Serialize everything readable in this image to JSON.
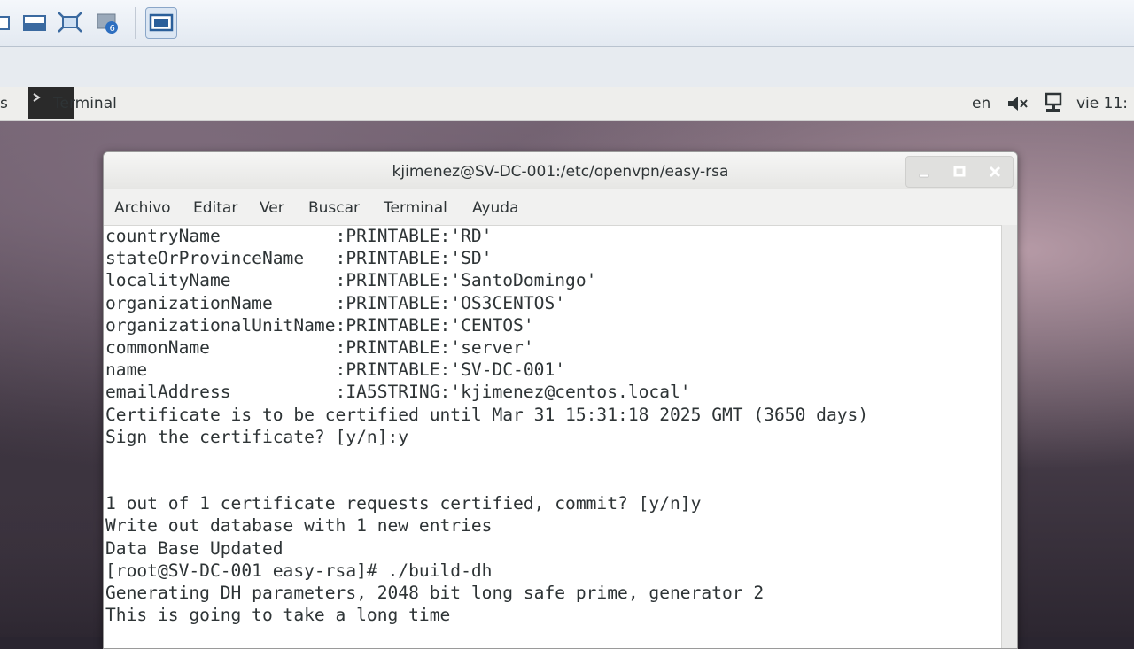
{
  "gnome_bar": {
    "activities": "s",
    "app_name": "Terminal",
    "language": "en",
    "clock": "vie 11:"
  },
  "window": {
    "title": "kjimenez@SV-DC-001:/etc/openvpn/easy-rsa",
    "menu": [
      "Archivo",
      "Editar",
      "Ver",
      "Buscar",
      "Terminal",
      "Ayuda"
    ]
  },
  "terminal": {
    "lines": [
      "countryName           :PRINTABLE:'RD'",
      "stateOrProvinceName   :PRINTABLE:'SD'",
      "localityName          :PRINTABLE:'SantoDomingo'",
      "organizationName      :PRINTABLE:'OS3CENTOS'",
      "organizationalUnitName:PRINTABLE:'CENTOS'",
      "commonName            :PRINTABLE:'server'",
      "name                  :PRINTABLE:'SV-DC-001'",
      "emailAddress          :IA5STRING:'kjimenez@centos.local'",
      "Certificate is to be certified until Mar 31 15:31:18 2025 GMT (3650 days)",
      "Sign the certificate? [y/n]:y",
      "",
      "",
      "1 out of 1 certificate requests certified, commit? [y/n]y",
      "Write out database with 1 new entries",
      "Data Base Updated",
      "[root@SV-DC-001 easy-rsa]# ./build-dh",
      "Generating DH parameters, 2048 bit long safe prime, generator 2",
      "This is going to take a long time"
    ]
  },
  "icons": [
    "window-icon",
    "minimize-vm-icon",
    "fullscreen-icon",
    "snapshot-icon",
    "console-view-icon",
    "terminal-app-icon",
    "volume-icon",
    "network-icon",
    "minimize-icon",
    "maximize-icon",
    "close-icon"
  ]
}
